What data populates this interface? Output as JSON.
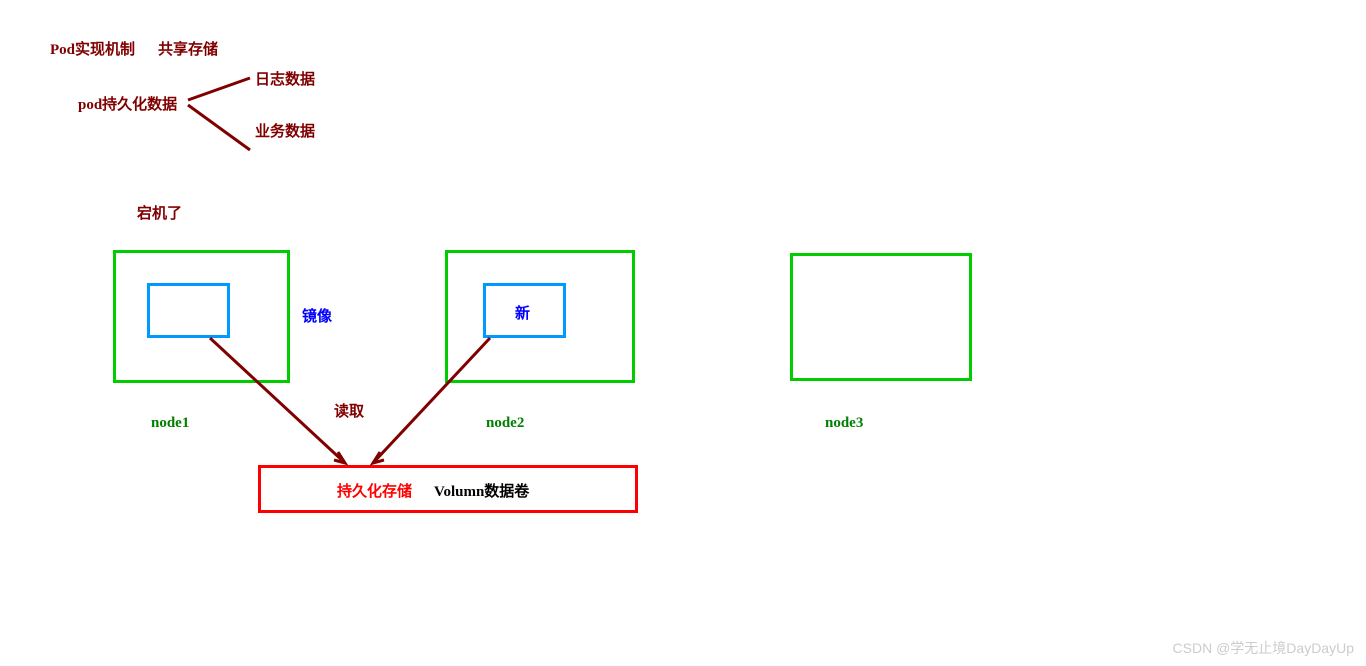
{
  "header": {
    "title1": "Pod实现机制",
    "title2": "共享存储",
    "persist_label": "pod持久化数据",
    "branch1": "日志数据",
    "branch2": "业务数据"
  },
  "status": {
    "down": "宕机了",
    "mirror": "镜像",
    "new": "新",
    "read": "读取"
  },
  "nodes": {
    "n1": "node1",
    "n2": "node2",
    "n3": "node3"
  },
  "storage": {
    "label1": "持久化存储",
    "label2": "Volumn数据卷"
  },
  "watermark": "CSDN @学无止境DayDayUp"
}
